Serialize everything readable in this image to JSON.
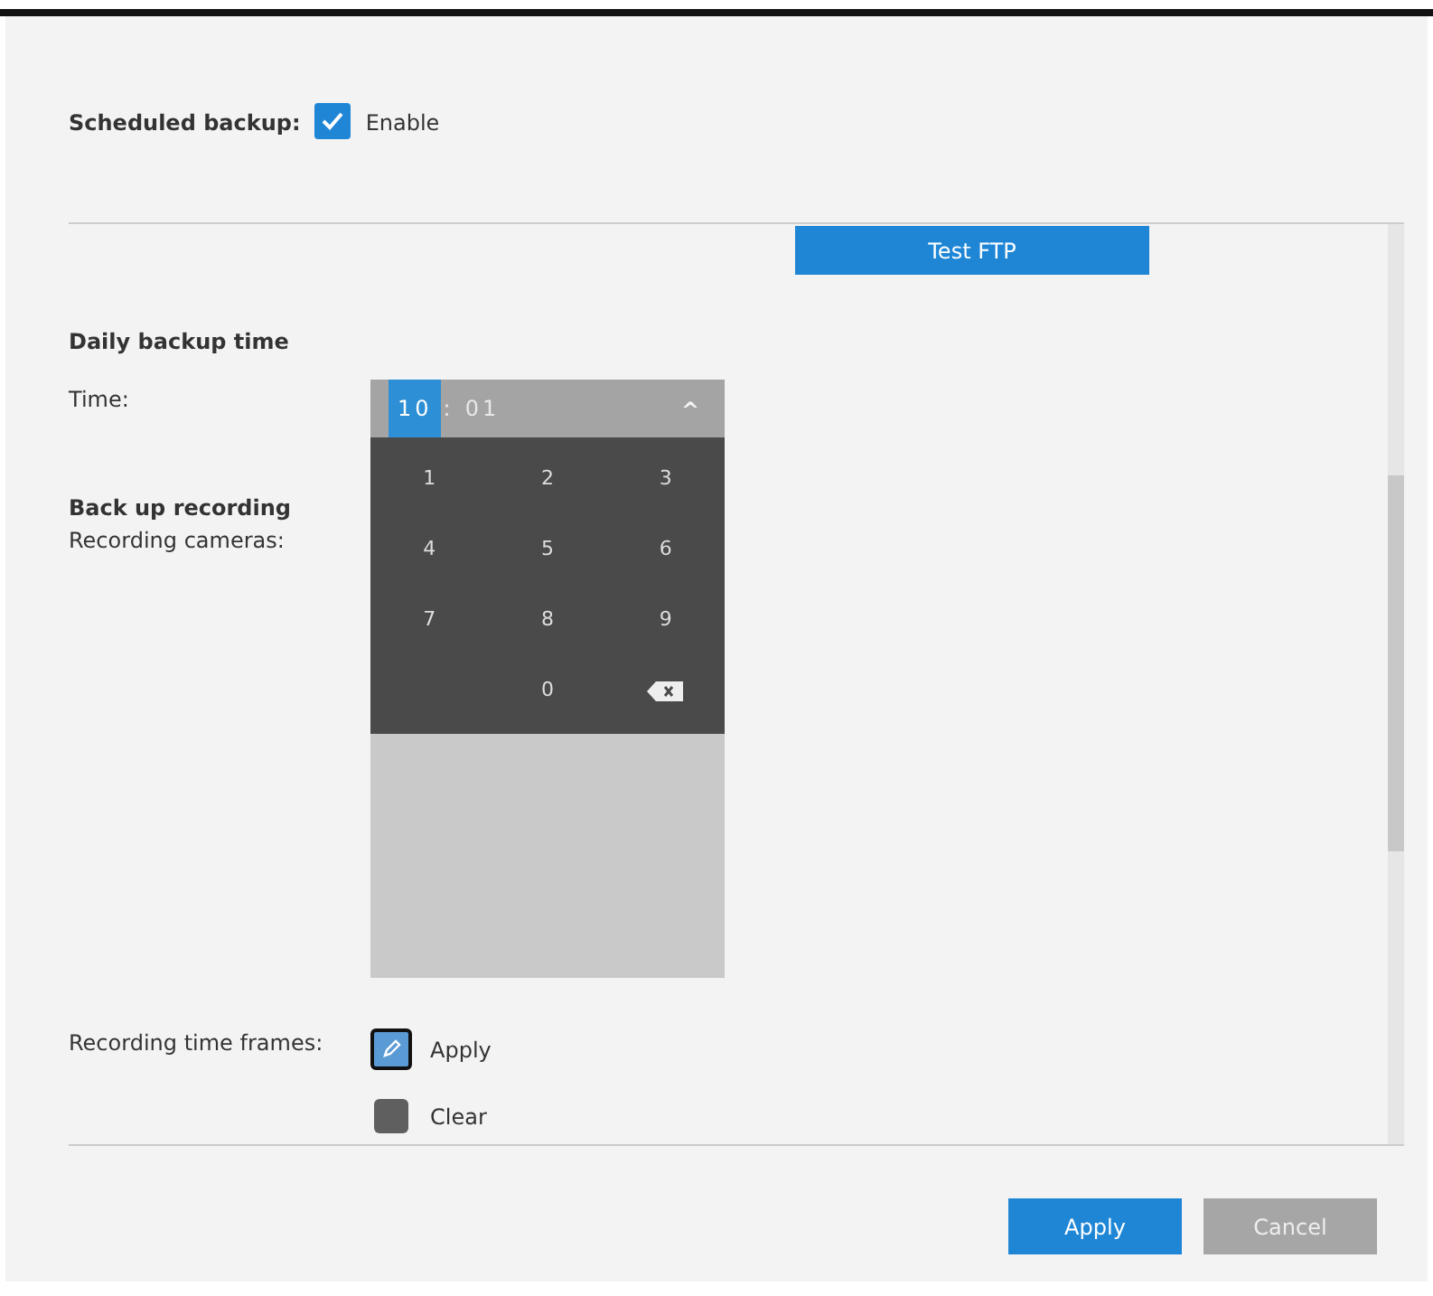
{
  "scheduled_backup": {
    "label": "Scheduled backup:",
    "checkbox_label": "Enable",
    "checked": true
  },
  "test_ftp_button": "Test FTP",
  "daily_backup": {
    "heading": "Daily backup time",
    "time_label": "Time:"
  },
  "time_picker": {
    "segments": [
      {
        "text": "10",
        "selected": true
      },
      {
        "text": ":",
        "kind": "separator"
      },
      {
        "text": "01",
        "selected": false
      }
    ],
    "collapse_glyph": "^",
    "keys": [
      {
        "kind": "digit",
        "text": "1"
      },
      {
        "kind": "digit",
        "text": "2"
      },
      {
        "kind": "digit",
        "text": "3"
      },
      {
        "kind": "digit",
        "text": "4"
      },
      {
        "kind": "digit",
        "text": "5"
      },
      {
        "kind": "digit",
        "text": "6"
      },
      {
        "kind": "digit",
        "text": "7"
      },
      {
        "kind": "digit",
        "text": "8"
      },
      {
        "kind": "digit",
        "text": "9"
      },
      {
        "kind": "blank"
      },
      {
        "kind": "digit",
        "text": "0"
      },
      {
        "kind": "backspace"
      }
    ]
  },
  "back_up_recording": {
    "heading": "Back up recording",
    "cameras_label": "Recording cameras:"
  },
  "time_frames": {
    "label": "Recording time frames:",
    "options": [
      {
        "kind": "apply",
        "text": "Apply",
        "selected": true
      },
      {
        "kind": "clear",
        "text": "Clear",
        "selected": false
      }
    ]
  },
  "buttons": [
    {
      "text": "Apply",
      "kind": "primary"
    },
    {
      "text": "Cancel",
      "kind": "secondary"
    }
  ]
}
